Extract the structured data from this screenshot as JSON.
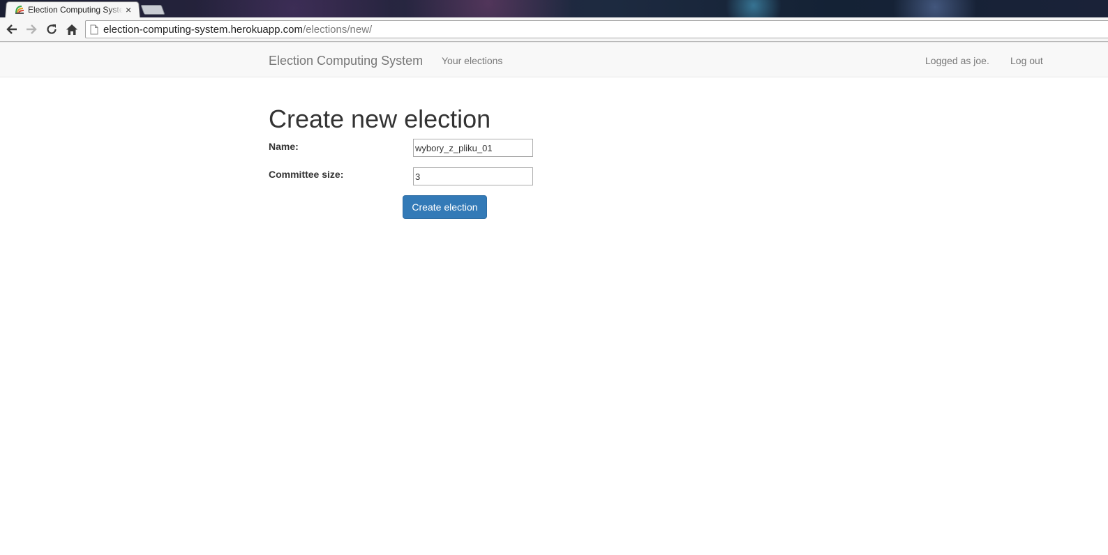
{
  "browser": {
    "tab": {
      "title": "Election Computing System",
      "close_glyph": "×",
      "favicon": "app-favicon-icon"
    },
    "url": {
      "host": "election-computing-system.herokuapp.com",
      "path": "/elections/new/"
    },
    "icons": {
      "back": "back-arrow-icon",
      "forward": "forward-arrow-icon",
      "reload": "reload-icon",
      "home": "home-icon",
      "page": "page-icon"
    }
  },
  "navbar": {
    "brand": "Election Computing System",
    "links": {
      "your_elections": "Your elections",
      "logged_as": "Logged as joe.",
      "log_out": "Log out"
    }
  },
  "form": {
    "title": "Create new election",
    "name_label": "Name:",
    "name_value": "wybory_z_pliku_01",
    "committee_label": "Committee size:",
    "committee_value": "3",
    "submit_label": "Create election"
  },
  "colors": {
    "primary_button": "#337ab7",
    "navbar_bg": "#f8f8f8",
    "navbar_text": "#777777",
    "heading_text": "#333333"
  }
}
